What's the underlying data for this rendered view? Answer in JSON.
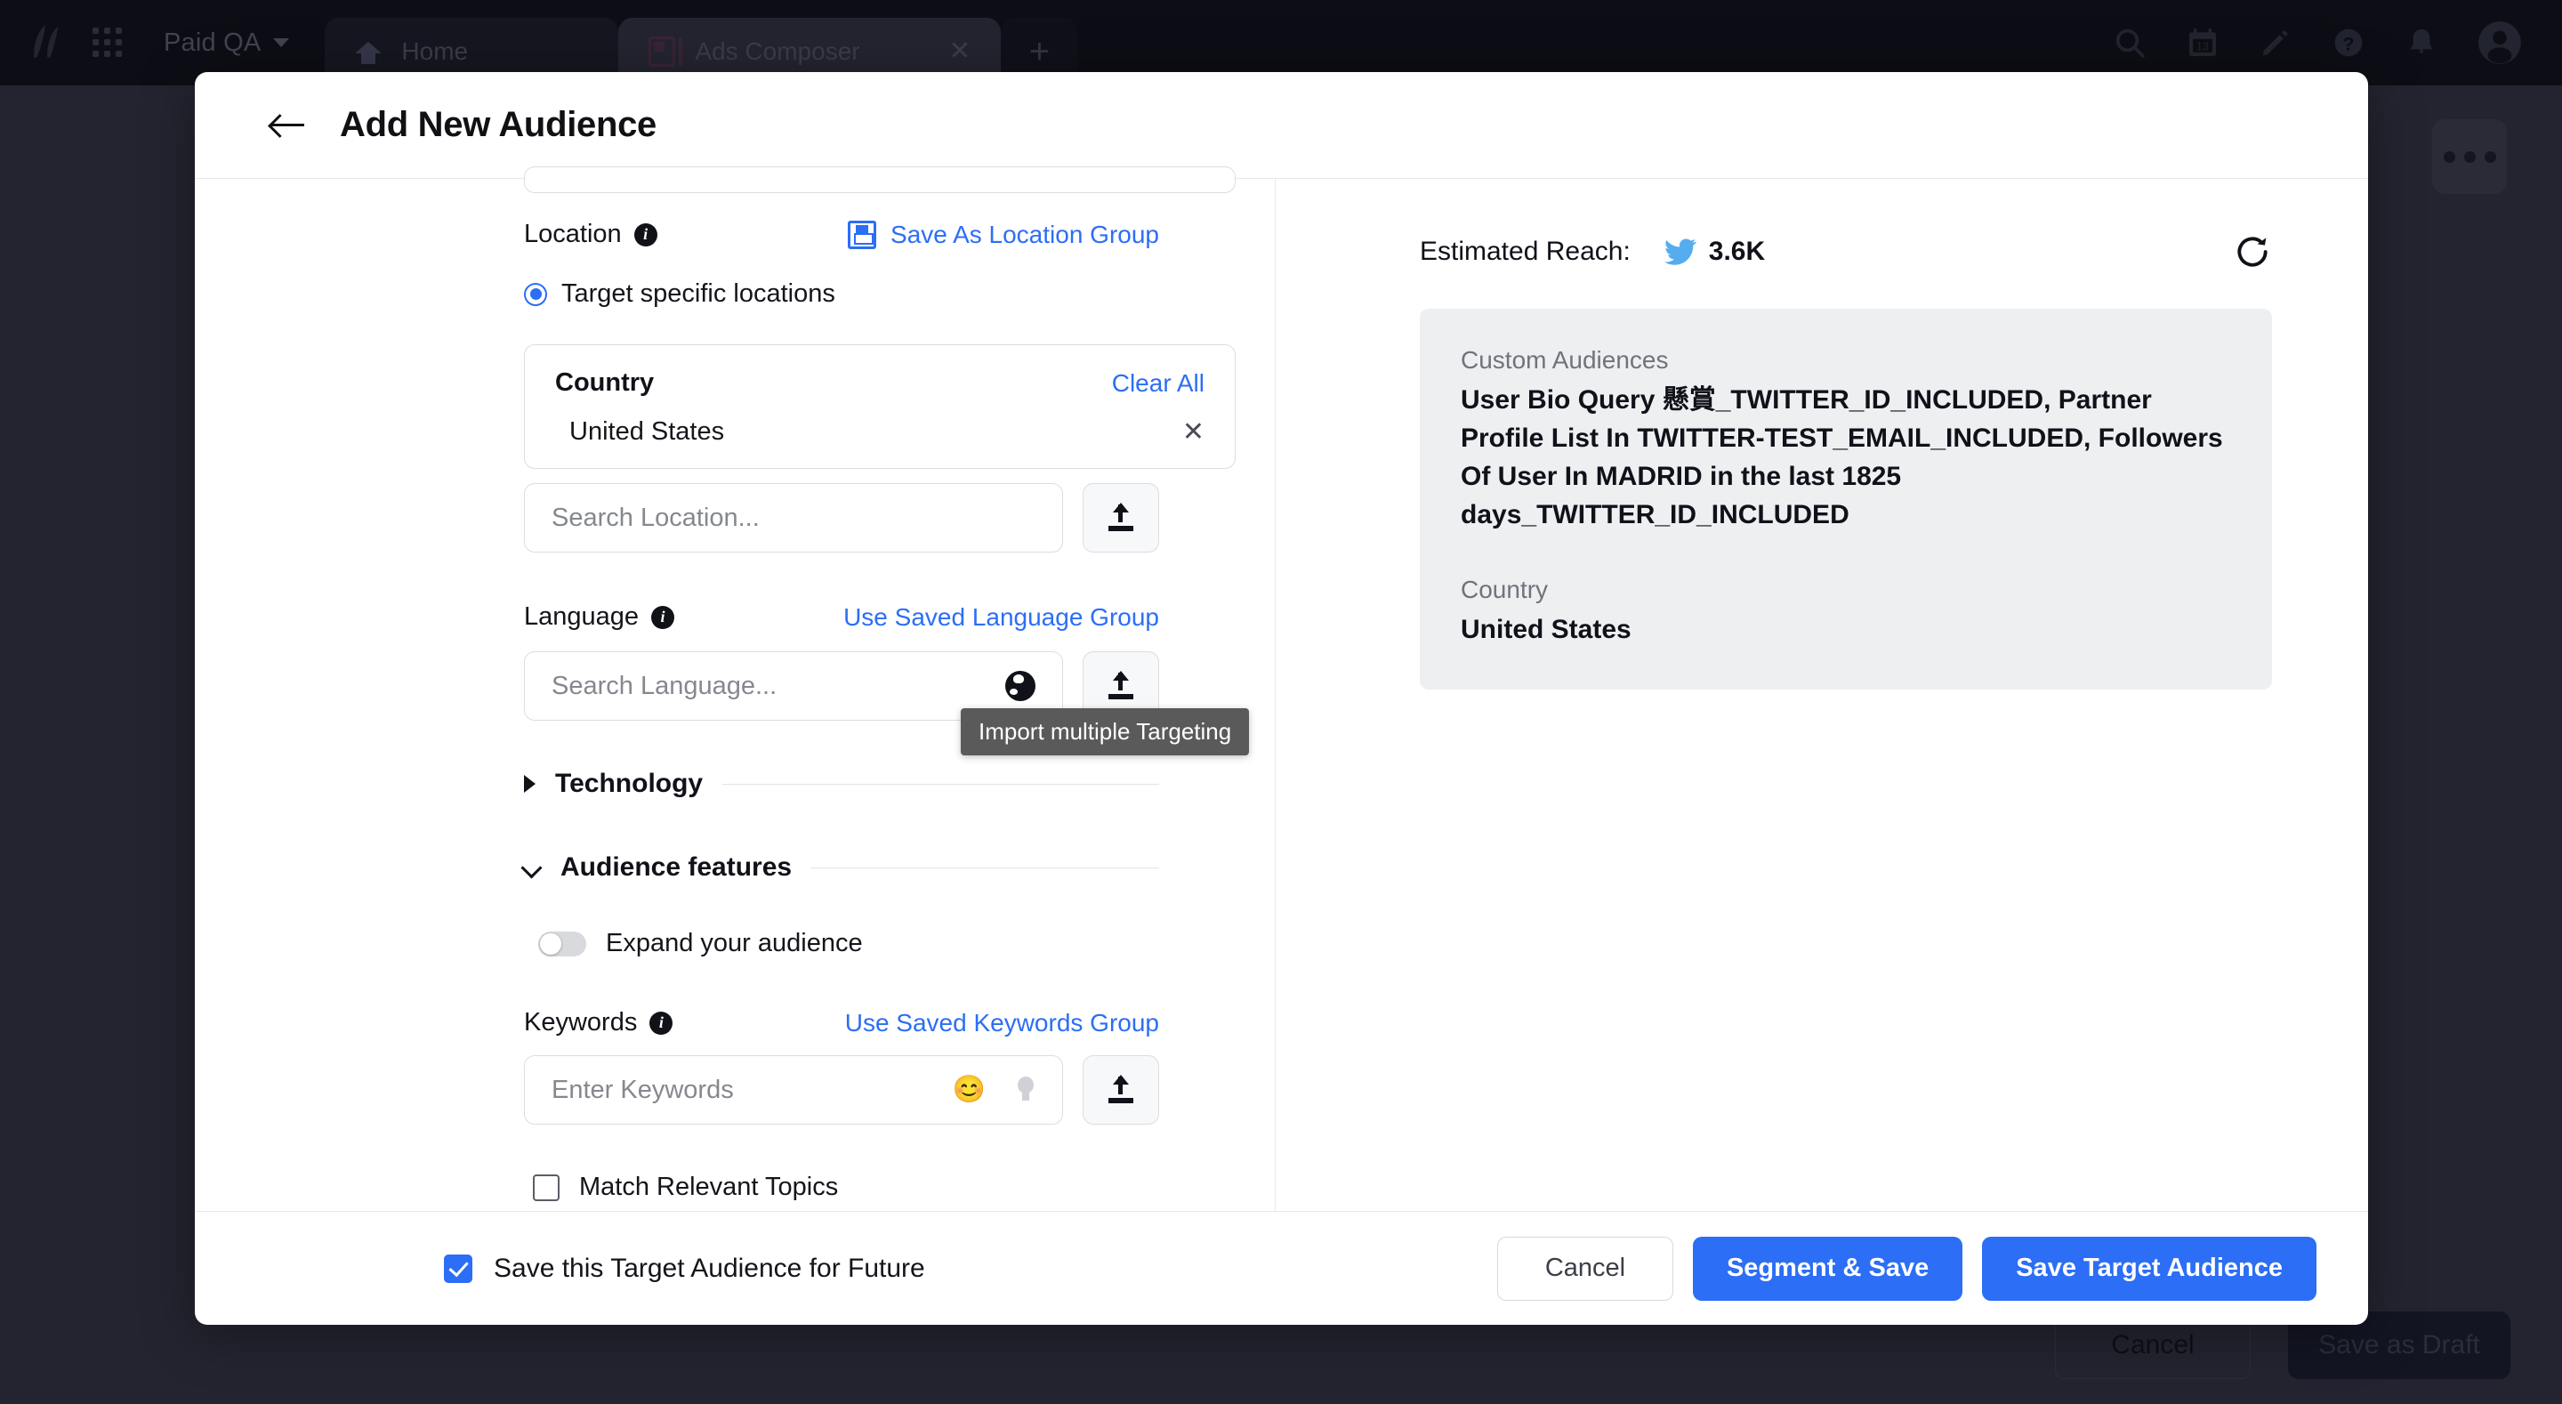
{
  "app": {
    "workspace": "Paid QA",
    "tabs": [
      {
        "label": "Home",
        "icon": "home-icon",
        "active": false
      },
      {
        "label": "Ads Composer",
        "icon": "compose-icon",
        "active": true
      }
    ],
    "new_tab_label": "+",
    "header_icons": [
      "search-icon",
      "calendar-icon",
      "edit-icon",
      "help-icon",
      "bell-icon",
      "avatar-icon"
    ],
    "calendar_day": "13",
    "background": {
      "overflow_menu": "•••",
      "cancel_label": "Cancel",
      "draft_label": "Save as Draft"
    }
  },
  "modal": {
    "title": "Add New Audience",
    "back_label": "back-arrow"
  },
  "location": {
    "label": "Location",
    "save_group_link": "Save As Location Group",
    "radio_label": "Target specific locations",
    "radio_selected": true,
    "selected_box": {
      "title": "Country",
      "clear_all": "Clear All",
      "items": [
        "United States"
      ]
    },
    "search_placeholder": "Search Location...",
    "import_tooltip": "Import multiple Targeting"
  },
  "language": {
    "label": "Language",
    "saved_group_link": "Use Saved Language Group",
    "search_placeholder": "Search Language..."
  },
  "technology": {
    "title": "Technology",
    "expanded": false
  },
  "audience_features": {
    "title": "Audience features",
    "expanded": true,
    "expand_toggle_label": "Expand your audience",
    "expand_toggle_on": false,
    "keywords": {
      "label": "Keywords",
      "saved_group_link": "Use Saved Keywords Group",
      "placeholder": "Enter Keywords",
      "emoji_icon": "😊"
    },
    "match_topics_label": "Match Relevant Topics",
    "match_topics_checked": false
  },
  "summary": {
    "reach_label": "Estimated Reach:",
    "reach_value": "3.6K",
    "reach_network": "twitter",
    "blocks": [
      {
        "label": "Custom Audiences",
        "value": "User Bio Query 懸賞_TWITTER_ID_INCLUDED, Partner Profile List In TWITTER-TEST_EMAIL_INCLUDED, Followers Of User In MADRID in the last 1825 days_TWITTER_ID_INCLUDED"
      },
      {
        "label": "Country",
        "value": "United States"
      }
    ]
  },
  "footer": {
    "save_future_label": "Save this Target Audience for Future",
    "save_future_checked": true,
    "cancel_label": "Cancel",
    "segment_save_label": "Segment & Save",
    "save_target_label": "Save Target Audience"
  },
  "colors": {
    "accent": "#2c6ef5",
    "app_bg": "#0d0e15",
    "card_bg": "#eeeff1",
    "tooltip_bg": "#5a5a5a"
  }
}
